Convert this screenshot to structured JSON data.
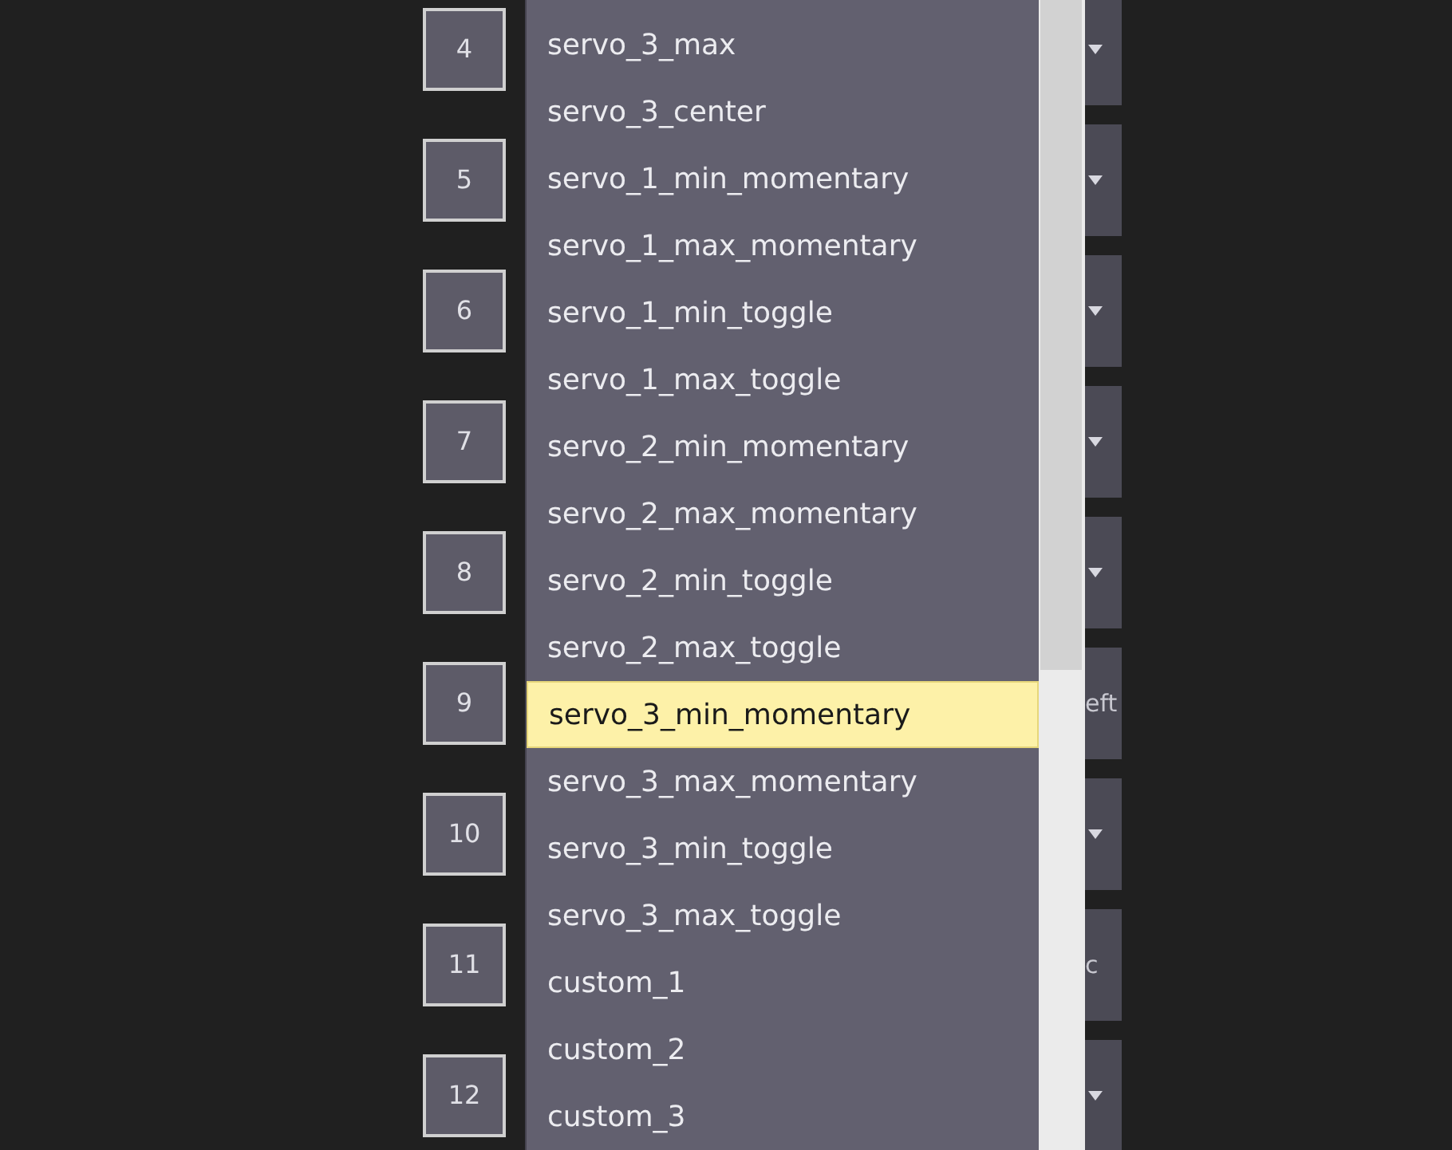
{
  "rows": [
    {
      "number": "4",
      "button": {
        "kind": "caret"
      }
    },
    {
      "number": "5",
      "button": {
        "kind": "caret"
      }
    },
    {
      "number": "6",
      "button": {
        "kind": "caret"
      }
    },
    {
      "number": "7",
      "button": {
        "kind": "caret"
      }
    },
    {
      "number": "8",
      "button": {
        "kind": "caret"
      }
    },
    {
      "number": "9",
      "button": {
        "kind": "text",
        "text": "eft"
      }
    },
    {
      "number": "10",
      "button": {
        "kind": "caret"
      }
    },
    {
      "number": "11",
      "button": {
        "kind": "text",
        "text": "c"
      }
    },
    {
      "number": "12",
      "button": {
        "kind": "caret"
      }
    }
  ],
  "dropdown": {
    "options": [
      {
        "label": "servo_3_max",
        "selected": false
      },
      {
        "label": "servo_3_center",
        "selected": false
      },
      {
        "label": "servo_1_min_momentary",
        "selected": false
      },
      {
        "label": "servo_1_max_momentary",
        "selected": false
      },
      {
        "label": "servo_1_min_toggle",
        "selected": false
      },
      {
        "label": "servo_1_max_toggle",
        "selected": false
      },
      {
        "label": "servo_2_min_momentary",
        "selected": false
      },
      {
        "label": "servo_2_max_momentary",
        "selected": false
      },
      {
        "label": "servo_2_min_toggle",
        "selected": false
      },
      {
        "label": "servo_2_max_toggle",
        "selected": false
      },
      {
        "label": "servo_3_min_momentary",
        "selected": true
      },
      {
        "label": "servo_3_max_momentary",
        "selected": false
      },
      {
        "label": "servo_3_min_toggle",
        "selected": false
      },
      {
        "label": "servo_3_max_toggle",
        "selected": false
      },
      {
        "label": "custom_1",
        "selected": false
      },
      {
        "label": "custom_2",
        "selected": false
      },
      {
        "label": "custom_3",
        "selected": false
      }
    ]
  }
}
